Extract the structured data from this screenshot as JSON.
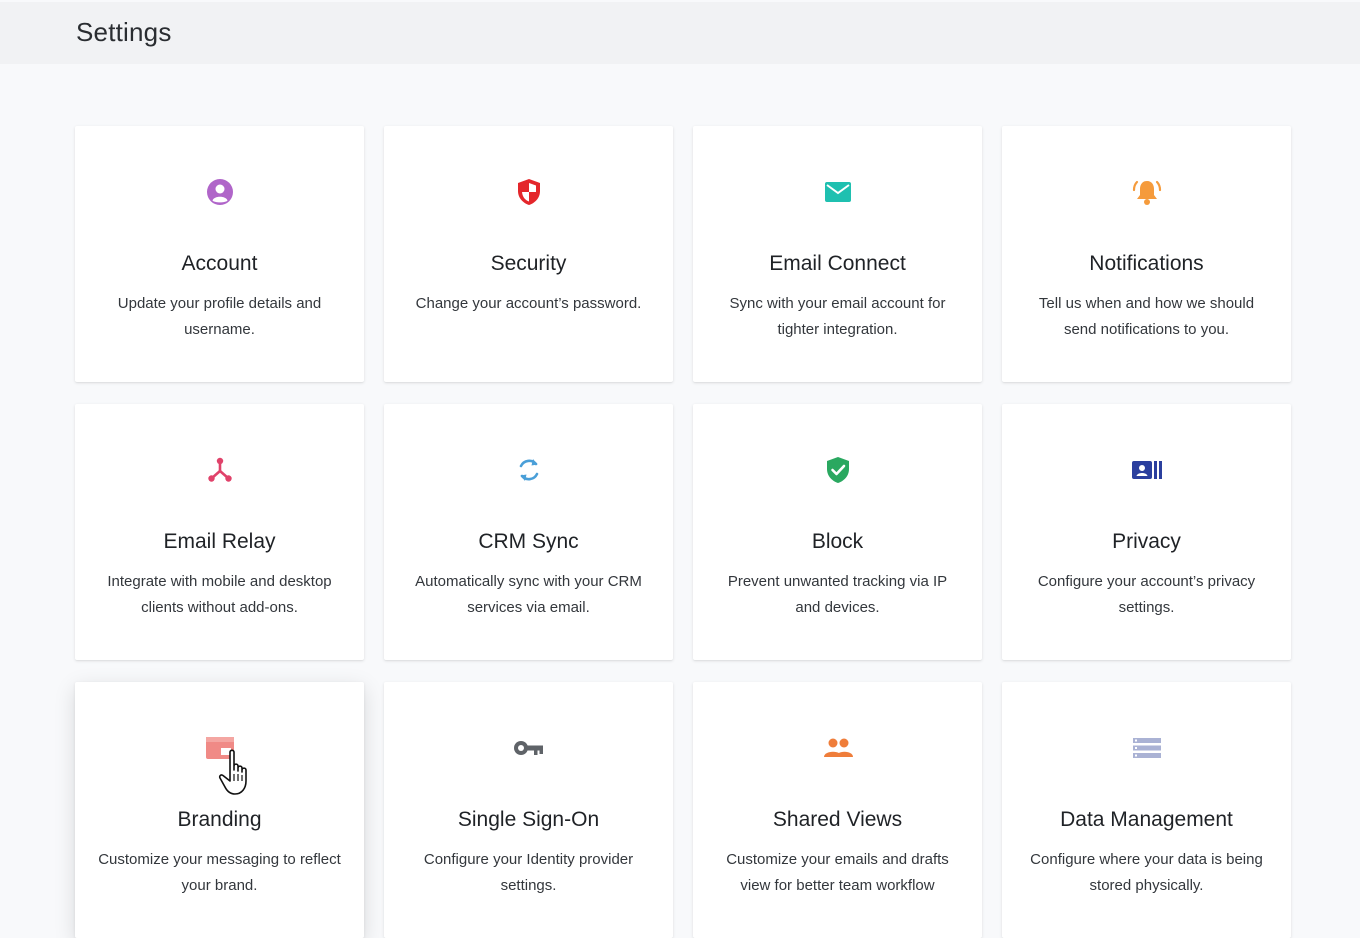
{
  "header": {
    "title": "Settings"
  },
  "cards": [
    {
      "title": "Account",
      "desc": "Update your profile details and username.",
      "icon": "account-icon",
      "color": "#b065c9"
    },
    {
      "title": "Security",
      "desc": "Change your account’s password.",
      "icon": "shield-icon",
      "color": "#e4262b"
    },
    {
      "title": "Email Connect",
      "desc": "Sync with your email account for tighter integration.",
      "icon": "envelope-icon",
      "color": "#1fc0b0"
    },
    {
      "title": "Notifications",
      "desc": "Tell us when and how we should send notifications to you.",
      "icon": "bell-icon",
      "color": "#f59b3c"
    },
    {
      "title": "Email Relay",
      "desc": "Integrate with mobile and desktop clients without add-ons.",
      "icon": "relay-icon",
      "color": "#e0426a"
    },
    {
      "title": "CRM Sync",
      "desc": "Automatically sync with your CRM services via email.",
      "icon": "sync-icon",
      "color": "#4a9fd8"
    },
    {
      "title": "Block",
      "desc": "Prevent unwanted tracking via IP and devices.",
      "icon": "shield-check-icon",
      "color": "#2aa860"
    },
    {
      "title": "Privacy",
      "desc": "Configure your account’s privacy settings.",
      "icon": "privacy-card-icon",
      "color": "#2b3f9e"
    },
    {
      "title": "Branding",
      "desc": "Customize your messaging to reflect your brand.",
      "icon": "branding-icon",
      "color": "#f08a86"
    },
    {
      "title": "Single Sign-On",
      "desc": "Configure your Identity provider settings.",
      "icon": "key-icon",
      "color": "#5f6368"
    },
    {
      "title": "Shared Views",
      "desc": "Customize your emails and drafts view for better team workflow",
      "icon": "users-icon",
      "color": "#ef7d3a"
    },
    {
      "title": "Data Management",
      "desc": "Configure where your data is being stored physically.",
      "icon": "database-list-icon",
      "color": "#aab2d4"
    }
  ]
}
